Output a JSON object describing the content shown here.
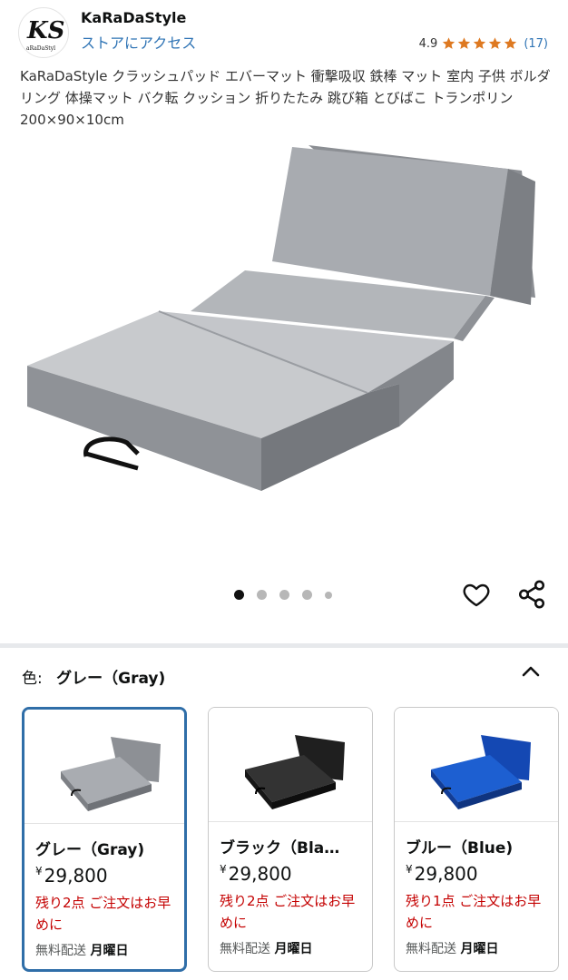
{
  "store": {
    "name": "KaRaDaStyle",
    "link_label": "ストアにアクセス",
    "logo_text": "KS",
    "logo_subtext": "aRaDaStyl"
  },
  "rating": {
    "value": "4.9",
    "stars": 5,
    "count": "(17)"
  },
  "product": {
    "title": "KaRaDaStyle クラッシュパッド エバーマット 衝撃吸収 鉄棒 マット 室内 子供 ボルダリング 体操マット バク転 クッション 折りたたみ 跳び箱 とびばこ トランポリン 200×90×10cm"
  },
  "carousel": {
    "count": 5,
    "active": 1
  },
  "icons": {
    "favorite": "heart-icon",
    "share": "share-icon",
    "collapse": "chevron-up-icon"
  },
  "variant": {
    "label": "色:",
    "selected": "グレー（Gray)",
    "options": [
      {
        "name": "グレー（Gray)",
        "yen": "¥",
        "price": "29,800",
        "stock": "残り2点 ご注文はお早めに",
        "ship_prefix": "無料配送",
        "ship_day": "月曜日",
        "color": "#a9acb1"
      },
      {
        "name": "ブラック（Bla…",
        "yen": "¥",
        "price": "29,800",
        "stock": "残り2点 ご注文はお早めに",
        "ship_prefix": "無料配送",
        "ship_day": "月曜日",
        "color": "#2b2b2b"
      },
      {
        "name": "ブルー（Blue)",
        "yen": "¥",
        "price": "29,800",
        "stock": "残り1点 ご注文はお早めに",
        "ship_prefix": "無料配送",
        "ship_day": "月曜日",
        "color": "#1d5fd1"
      }
    ]
  },
  "colors": {
    "link": "#2f74b5",
    "star": "#de7921",
    "stock": "#c40000",
    "selected_border": "#2f6ea8"
  }
}
